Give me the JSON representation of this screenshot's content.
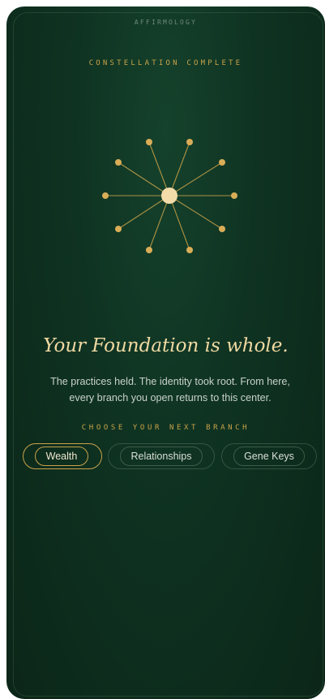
{
  "app": {
    "brand": "AFFIRMOLOGY"
  },
  "status": {
    "kicker": "CONSTELLATION COMPLETE"
  },
  "main": {
    "headline": "Your Foundation is whole.",
    "body_line1": "The practices held. The identity took root. From here,",
    "body_line2": "every branch you open returns to this center.",
    "branch_prompt": "CHOOSE YOUR NEXT BRANCH"
  },
  "branches": {
    "items": [
      {
        "label": "Wealth",
        "selected": true
      },
      {
        "label": "Relationships",
        "selected": false
      },
      {
        "label": "Gene Keys",
        "selected": false
      }
    ]
  },
  "colors": {
    "background": "#0f3322",
    "accent_gold": "#c9a24a",
    "headline": "#f0d9a2",
    "center_node": "#f3dcaa"
  },
  "constellation": {
    "node_icon": "star-node-icon",
    "center_icon": "center-node-icon"
  }
}
